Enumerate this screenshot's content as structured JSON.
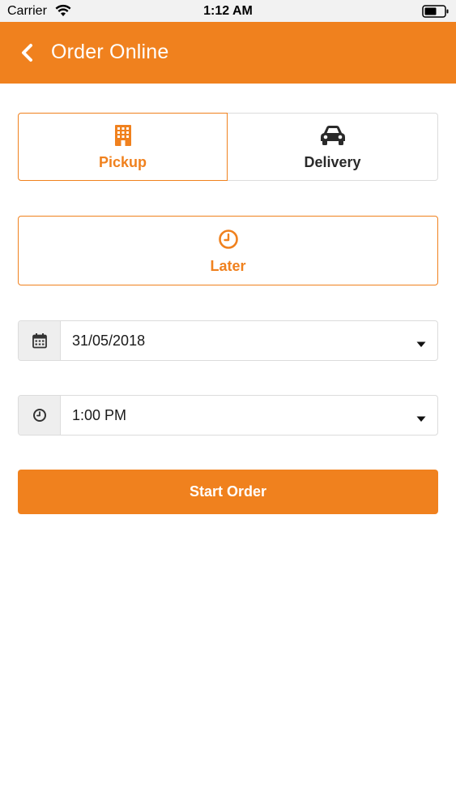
{
  "status_bar": {
    "carrier": "Carrier",
    "time": "1:12 AM"
  },
  "header": {
    "title": "Order Online",
    "background_color": "#f0811e"
  },
  "order_type": {
    "options": [
      {
        "label": "Pickup",
        "icon": "building-icon",
        "selected": true
      },
      {
        "label": "Delivery",
        "icon": "car-icon",
        "selected": false
      }
    ]
  },
  "timing": {
    "label": "Later",
    "icon": "clock-icon",
    "selected": true
  },
  "date_select": {
    "value": "31/05/2018",
    "icon": "calendar-icon"
  },
  "time_select": {
    "value": "1:00 PM",
    "icon": "clock-icon"
  },
  "start_button": {
    "label": "Start Order"
  },
  "colors": {
    "accent": "#f0811e",
    "text_dark": "#2a2a2a",
    "border": "#dcdcdc"
  }
}
